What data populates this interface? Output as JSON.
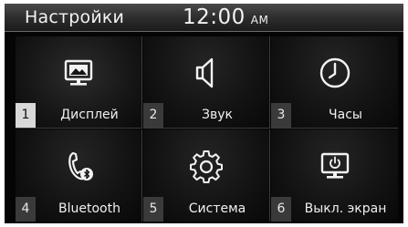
{
  "header": {
    "title": "Настройки",
    "time": "12:00",
    "ampm": "AM"
  },
  "menu": [
    {
      "number": "1",
      "label": "Дисплей",
      "icon": "display-icon",
      "selected": true
    },
    {
      "number": "2",
      "label": "Звук",
      "icon": "speaker-icon",
      "selected": false
    },
    {
      "number": "3",
      "label": "Часы",
      "icon": "clock-icon",
      "selected": false
    },
    {
      "number": "4",
      "label": "Bluetooth",
      "icon": "bluetooth-phone-icon",
      "selected": false
    },
    {
      "number": "5",
      "label": "Система",
      "icon": "gear-icon",
      "selected": false
    },
    {
      "number": "6",
      "label": "Выкл. экран",
      "icon": "screen-off-icon",
      "selected": false
    }
  ]
}
